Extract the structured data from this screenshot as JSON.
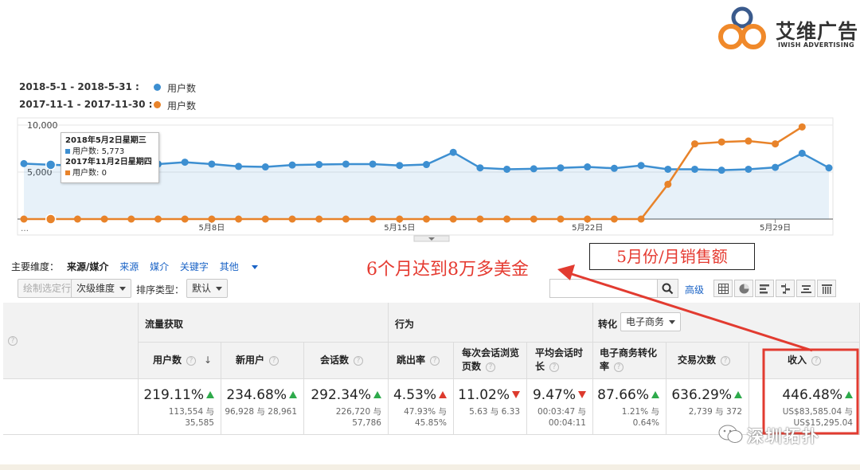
{
  "brand": {
    "name_cn": "艾维广告",
    "name_en": "IWISH ADVERTISING"
  },
  "legend": [
    {
      "range": "2018-5-1 - 2018-5-31 :",
      "metric": "用户数",
      "color": "#3d8fd1"
    },
    {
      "range": "2017-11-1 - 2017-11-30 :",
      "metric": "用户数",
      "color": "#e8832a"
    }
  ],
  "chart_data": {
    "type": "line",
    "ylabel": "",
    "ylim": [
      0,
      10000
    ],
    "y_ticks": [
      "10,000",
      "5,000"
    ],
    "x_ticks": [
      "5月8日",
      "5月15日",
      "5月22日",
      "5月29日"
    ],
    "x": [
      1,
      2,
      3,
      4,
      5,
      6,
      7,
      8,
      9,
      10,
      11,
      12,
      13,
      14,
      15,
      16,
      17,
      18,
      19,
      20,
      21,
      22,
      23,
      24,
      25,
      26,
      27,
      28,
      29,
      30,
      31
    ],
    "series": [
      {
        "name": "2018-5-1 - 2018-5-31",
        "color": "#3d8fd1",
        "values": [
          5900,
          5773,
          5700,
          5750,
          5700,
          5850,
          6050,
          5850,
          5600,
          5550,
          5750,
          5800,
          5850,
          5850,
          5700,
          5800,
          7100,
          5450,
          5300,
          5350,
          5450,
          5550,
          5400,
          5700,
          5300,
          5300,
          5200,
          5300,
          5500,
          7000,
          5450
        ]
      },
      {
        "name": "2017-11-1 - 2017-11-30",
        "color": "#e8832a",
        "values": [
          0,
          0,
          0,
          0,
          0,
          0,
          0,
          0,
          0,
          0,
          0,
          0,
          0,
          0,
          0,
          0,
          0,
          0,
          0,
          0,
          0,
          0,
          0,
          0,
          3700,
          8000,
          8200,
          8300,
          8000,
          9800,
          null
        ]
      }
    ],
    "tooltip": {
      "date1": "2018年5月2日星期三",
      "label1": "用户数:",
      "value1": "5,773",
      "date2": "2017年11月2日星期四",
      "label2": "用户数:",
      "value2": "0"
    },
    "grid": true
  },
  "dimension": {
    "label": "主要维度：",
    "active": "来源/媒介",
    "links": [
      "来源",
      "媒介",
      "关键字",
      "其他"
    ]
  },
  "annotations": {
    "main": "6个月达到8万多美金",
    "box": "5月份/月销售额"
  },
  "toolbar": {
    "plot_rows": "绘制选定行",
    "secondary_dim": "次级维度",
    "sort_label": "排序类型：",
    "sort_value": "默认",
    "search_placeholder": "",
    "advanced": "高级"
  },
  "table": {
    "groups": {
      "acquisition": "流量获取",
      "behavior": "行为",
      "conversion": "转化",
      "conversion_select": "电子商务"
    },
    "columns": [
      {
        "label": "用户数",
        "value": "219.11%",
        "trend": "up-green",
        "sub1": "113,554 与",
        "sub2": "35,585"
      },
      {
        "label": "新用户",
        "value": "234.68%",
        "trend": "up-green",
        "sub1": "96,928 与 28,961",
        "sub2": ""
      },
      {
        "label": "会话数",
        "value": "292.34%",
        "trend": "up-green",
        "sub1": "226,720 与",
        "sub2": "57,786"
      },
      {
        "label": "跳出率",
        "value": "4.53%",
        "trend": "up-red",
        "sub1": "47.93% 与",
        "sub2": "45.85%"
      },
      {
        "label": "每次会话浏览页数",
        "value": "11.02%",
        "trend": "down-red",
        "sub1": "5.63 与 6.33",
        "sub2": ""
      },
      {
        "label": "平均会话时长",
        "value": "9.47%",
        "trend": "down-red",
        "sub1": "00:03:47 与",
        "sub2": "00:04:11"
      },
      {
        "label": "电子商务转化率",
        "value": "87.66%",
        "trend": "up-green",
        "sub1": "1.21% 与",
        "sub2": "0.64%"
      },
      {
        "label": "交易次数",
        "value": "636.29%",
        "trend": "up-green",
        "sub1": "2,739 与 372",
        "sub2": ""
      },
      {
        "label": "收入",
        "value": "446.48%",
        "trend": "up-green",
        "sub1": "US$83,585.04 与",
        "sub2": "US$15,295.04"
      }
    ]
  },
  "watermark": "深圳拓扑"
}
